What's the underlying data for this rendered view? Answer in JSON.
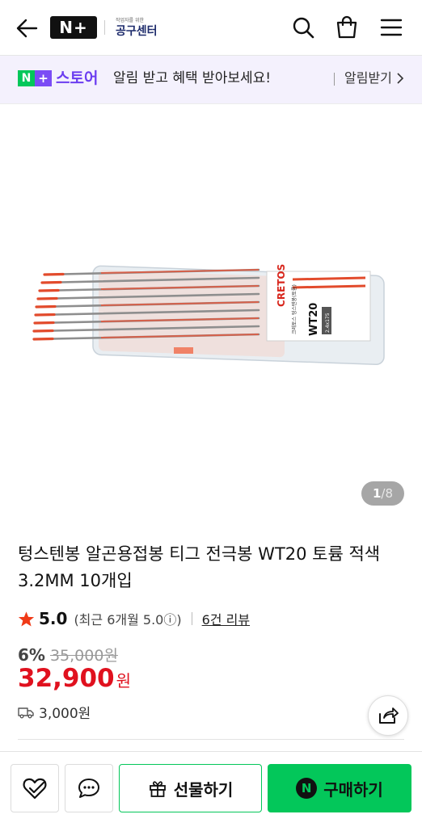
{
  "header": {
    "logo_text": "N+",
    "logo_sub_small": "작업자를 위한",
    "logo_sub_big": "공구센터"
  },
  "banner": {
    "badge_n": "N",
    "badge_plus": "+",
    "store_label": "스토어",
    "message": "알림 받고 혜택 받아보세요!",
    "link_label": "알림받기"
  },
  "gallery": {
    "current": "1",
    "total": "8",
    "separator": "/",
    "box_brand": "CRETOS",
    "box_model": "WT20",
    "box_label": "크레토스 텅스텐봉(토륨)",
    "box_size": "2.4x175"
  },
  "product": {
    "title": "텅스텐봉 알곤용접봉 티그 전극봉 WT20 토륨 적색 3.2MM 10개입",
    "rating": "5.0",
    "rating_note": "(최근 6개월 5.0ⓘ)",
    "review_link": "6건 리뷰",
    "discount": "6%",
    "original_price": "35,000원",
    "price": "32,900",
    "price_unit": "원",
    "shipping_fee": "3,000원"
  },
  "bottom": {
    "gift_label": "선물하기",
    "buy_mark": "N",
    "buy_label": "구매하기"
  },
  "colors": {
    "naver_green": "#03c75a",
    "store_purple": "#6b3df0",
    "price_red": "#e0111e",
    "star_red": "#f03a17"
  }
}
